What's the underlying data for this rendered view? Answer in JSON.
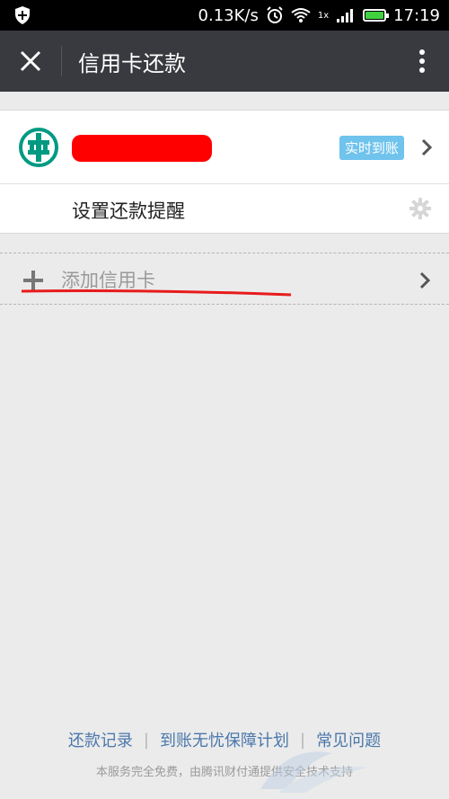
{
  "status_bar": {
    "network_speed": "0.13K/s",
    "signal_label": "1x",
    "time": "17:19"
  },
  "app_bar": {
    "title": "信用卡还款"
  },
  "card": {
    "name": "",
    "badge": "实时到账",
    "reminder_label": "设置还款提醒"
  },
  "add_card": {
    "label": "添加信用卡"
  },
  "footer": {
    "links": [
      "还款记录",
      "到账无忧保障计划",
      "常见问题"
    ],
    "separator": "|",
    "note": "本服务完全免费，由腾讯财付通提供安全技术支持"
  },
  "colors": {
    "appbar": "#393a3f",
    "badge": "#6fc3ec",
    "link": "#4a77ab",
    "bank_logo": "#009a83",
    "highlight": "#ff0000"
  }
}
